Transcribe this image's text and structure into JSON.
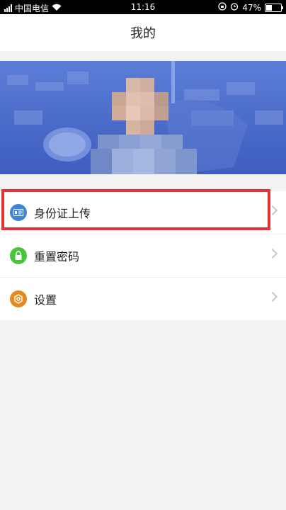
{
  "status_bar": {
    "carrier": "中国电信",
    "time": "11:16",
    "battery_percent": "47%",
    "battery_level": 0.47
  },
  "header": {
    "title": "我的"
  },
  "menu": {
    "items": [
      {
        "label": "身份证上传",
        "icon": "id-card-icon",
        "color": "#3f86d8"
      },
      {
        "label": "重置密码",
        "icon": "lock-icon",
        "color": "#48c53a"
      },
      {
        "label": "设置",
        "icon": "gear-icon",
        "color": "#e6891f"
      }
    ]
  },
  "highlight": {
    "color": "#e23434"
  }
}
